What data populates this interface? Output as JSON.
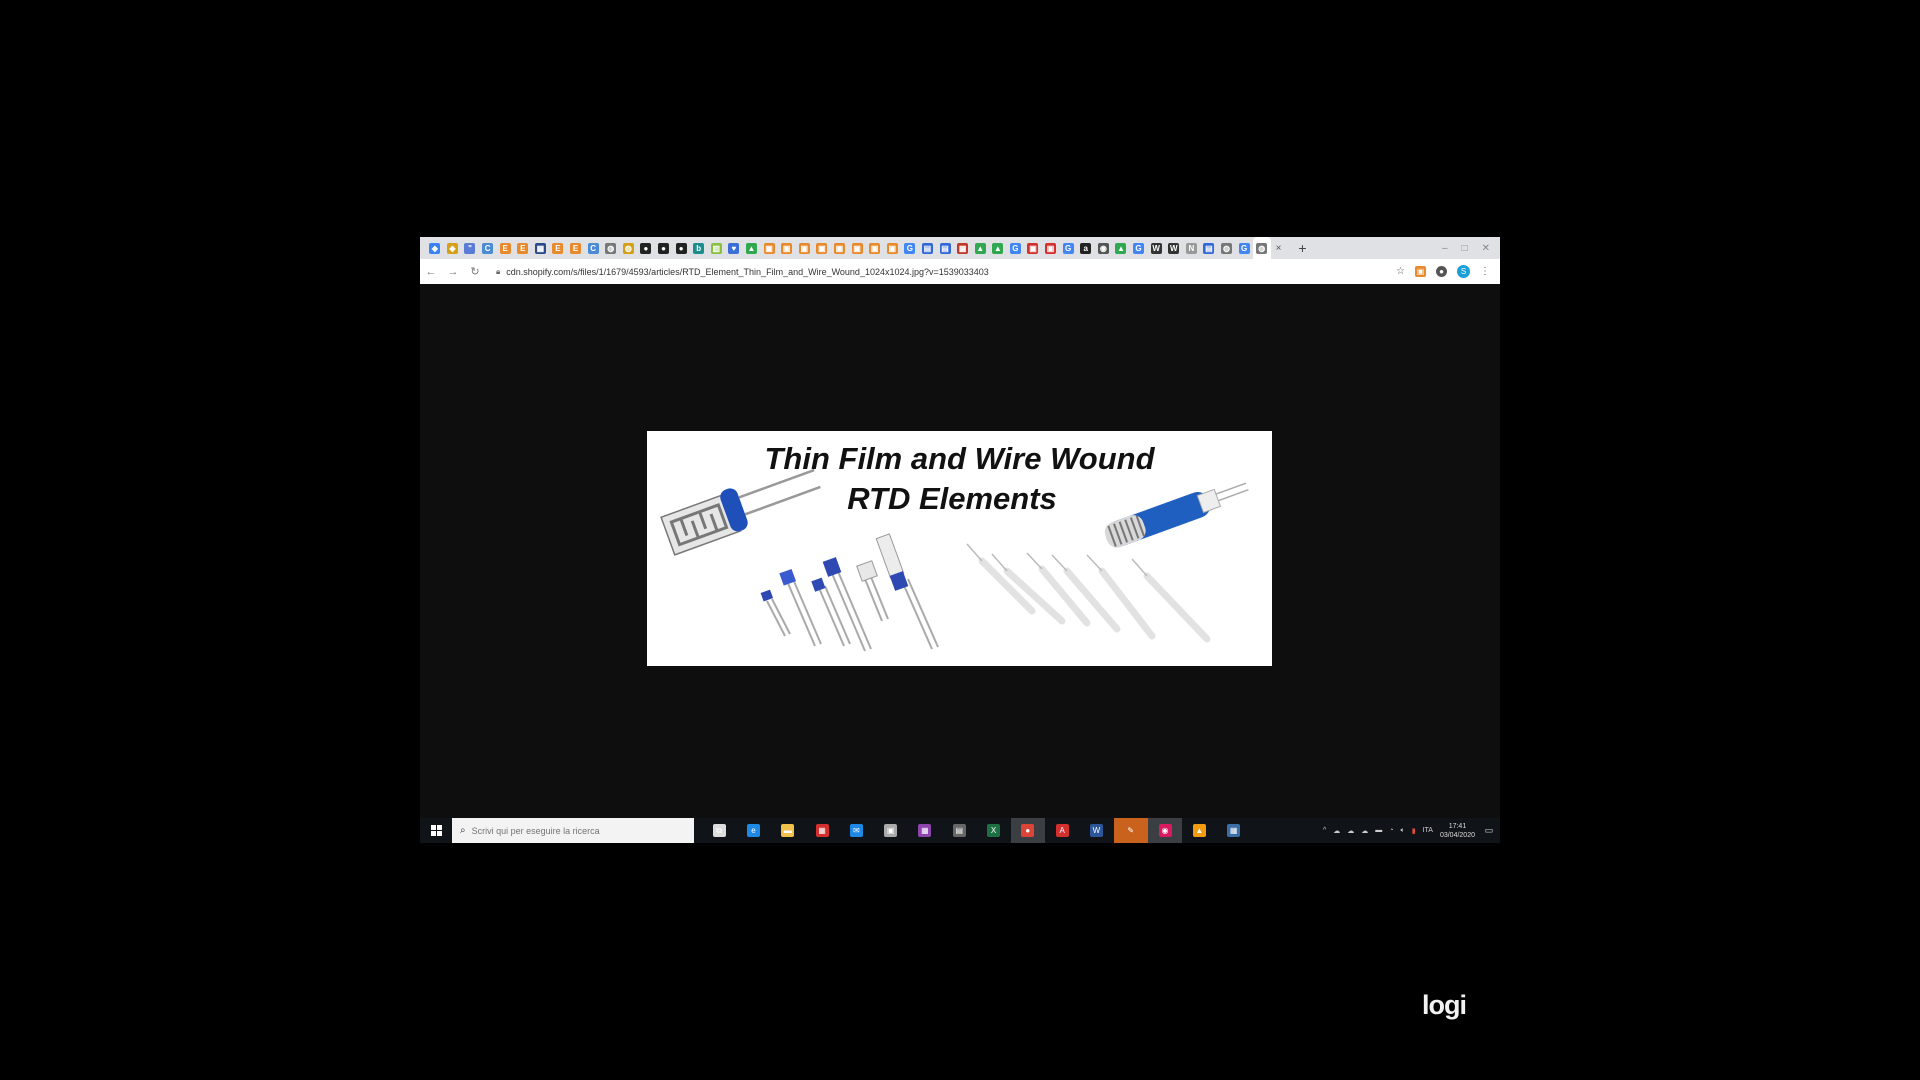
{
  "browser": {
    "tab_favicons": [
      {
        "icon": "diamond-icon",
        "color": "#3b82f6",
        "glyph": "◆"
      },
      {
        "icon": "diamond-icon",
        "color": "#d4a017",
        "glyph": "◆"
      },
      {
        "icon": "blog-icon",
        "color": "#5a7bd6",
        "glyph": "\""
      },
      {
        "icon": "c-icon",
        "color": "#4b8bd6",
        "glyph": "C"
      },
      {
        "icon": "e-icon",
        "color": "#e8892b",
        "glyph": "E"
      },
      {
        "icon": "e-icon",
        "color": "#e8892b",
        "glyph": "E"
      },
      {
        "icon": "grid-icon",
        "color": "#2a4a8a",
        "glyph": "▦"
      },
      {
        "icon": "e-icon",
        "color": "#e8892b",
        "glyph": "E"
      },
      {
        "icon": "e-icon",
        "color": "#e8892b",
        "glyph": "E"
      },
      {
        "icon": "c-icon",
        "color": "#4b8bd6",
        "glyph": "C"
      },
      {
        "icon": "globe-icon",
        "color": "#777",
        "glyph": "◍"
      },
      {
        "icon": "globe-icon",
        "color": "#d4a017",
        "glyph": "◍"
      },
      {
        "icon": "github-icon",
        "color": "#222",
        "glyph": "●"
      },
      {
        "icon": "github-icon",
        "color": "#222",
        "glyph": "●"
      },
      {
        "icon": "github-icon",
        "color": "#222",
        "glyph": "●"
      },
      {
        "icon": "b-icon",
        "color": "#1c8c8c",
        "glyph": "b"
      },
      {
        "icon": "sheet-icon",
        "color": "#8bbf3f",
        "glyph": "▥"
      },
      {
        "icon": "heart-icon",
        "color": "#3b6ed6",
        "glyph": "♥"
      },
      {
        "icon": "drive-icon",
        "color": "#2fa84f",
        "glyph": "▲"
      },
      {
        "icon": "orange-icon",
        "color": "#e8892b",
        "glyph": "▣"
      },
      {
        "icon": "orange-icon",
        "color": "#e8892b",
        "glyph": "▣"
      },
      {
        "icon": "orange-icon",
        "color": "#e8892b",
        "glyph": "▣"
      },
      {
        "icon": "orange-icon",
        "color": "#e8892b",
        "glyph": "▣"
      },
      {
        "icon": "orange-icon",
        "color": "#e8892b",
        "glyph": "▣"
      },
      {
        "icon": "orange-icon",
        "color": "#e8892b",
        "glyph": "▣"
      },
      {
        "icon": "orange-icon",
        "color": "#e8892b",
        "glyph": "▣"
      },
      {
        "icon": "orange-icon",
        "color": "#e8892b",
        "glyph": "▣"
      },
      {
        "icon": "google-icon",
        "color": "#4285f4",
        "glyph": "G"
      },
      {
        "icon": "doc-icon",
        "color": "#3367d6",
        "glyph": "▤"
      },
      {
        "icon": "doc-icon",
        "color": "#3367d6",
        "glyph": "▤"
      },
      {
        "icon": "flag-icon",
        "color": "#c0392b",
        "glyph": "▦"
      },
      {
        "icon": "drive-icon",
        "color": "#2fa84f",
        "glyph": "▲"
      },
      {
        "icon": "drive-icon",
        "color": "#2fa84f",
        "glyph": "▲"
      },
      {
        "icon": "google-icon",
        "color": "#4285f4",
        "glyph": "G"
      },
      {
        "icon": "red-icon",
        "color": "#d32f2f",
        "glyph": "▣"
      },
      {
        "icon": "red-icon",
        "color": "#d32f2f",
        "glyph": "▣"
      },
      {
        "icon": "google-icon",
        "color": "#4285f4",
        "glyph": "G"
      },
      {
        "icon": "amazon-icon",
        "color": "#222",
        "glyph": "a"
      },
      {
        "icon": "eye-icon",
        "color": "#555",
        "glyph": "◉"
      },
      {
        "icon": "drive-icon",
        "color": "#2fa84f",
        "glyph": "▲"
      },
      {
        "icon": "google-icon",
        "color": "#4285f4",
        "glyph": "G"
      },
      {
        "icon": "wikipedia-icon",
        "color": "#333",
        "glyph": "W"
      },
      {
        "icon": "wikipedia-icon",
        "color": "#333",
        "glyph": "W"
      },
      {
        "icon": "ms-icon",
        "color": "#999",
        "glyph": "N"
      },
      {
        "icon": "doc-icon",
        "color": "#3367d6",
        "glyph": "▤"
      },
      {
        "icon": "globe-icon",
        "color": "#777",
        "glyph": "◍"
      },
      {
        "icon": "google-icon",
        "color": "#4285f4",
        "glyph": "G"
      },
      {
        "icon": "globe-icon",
        "color": "#777",
        "glyph": "◍"
      }
    ],
    "active_tab_index": 47,
    "tab_close": "×",
    "new_tab": "+",
    "url": "cdn.shopify.com/s/files/1/1679/4593/articles/RTD_Element_Thin_Film_and_Wire_Wound_1024x1024.jpg?v=1539033403",
    "extension_colors": [
      "#e8892b",
      "#555"
    ],
    "profile_initial": "S"
  },
  "image": {
    "title_line1": "Thin Film and Wire Wound",
    "title_line2": "RTD Elements"
  },
  "taskbar": {
    "search_placeholder": "Scrivi qui per eseguire la ricerca",
    "apps": [
      {
        "icon": "task-view-icon",
        "color": "#ddd",
        "glyph": "⧉",
        "state": ""
      },
      {
        "icon": "edge-icon",
        "color": "#1e88e5",
        "glyph": "e",
        "state": ""
      },
      {
        "icon": "file-explorer-icon",
        "color": "#f0c14b",
        "glyph": "▬",
        "state": ""
      },
      {
        "icon": "calendar-icon",
        "color": "#d32f2f",
        "glyph": "▦",
        "state": ""
      },
      {
        "icon": "mail-icon",
        "color": "#1e88e5",
        "glyph": "✉",
        "state": ""
      },
      {
        "icon": "printer-icon",
        "color": "#aaa",
        "glyph": "▣",
        "state": ""
      },
      {
        "icon": "winrar-icon",
        "color": "#8e44ad",
        "glyph": "▦",
        "state": ""
      },
      {
        "icon": "notes-icon",
        "color": "#666",
        "glyph": "▤",
        "state": ""
      },
      {
        "icon": "excel-icon",
        "color": "#1d7044",
        "glyph": "X",
        "state": ""
      },
      {
        "icon": "chrome-icon",
        "color": "#db4437",
        "glyph": "●",
        "state": "running"
      },
      {
        "icon": "acrobat-icon",
        "color": "#d32f2f",
        "glyph": "A",
        "state": ""
      },
      {
        "icon": "word-icon",
        "color": "#2b579a",
        "glyph": "W",
        "state": ""
      },
      {
        "icon": "pen-icon",
        "color": "#c8621c",
        "glyph": "✎",
        "state": "orange"
      },
      {
        "icon": "screen-recorder-icon",
        "color": "#d81b60",
        "glyph": "◉",
        "state": "running"
      },
      {
        "icon": "vlc-icon",
        "color": "#f39c12",
        "glyph": "▲",
        "state": ""
      },
      {
        "icon": "network-tool-icon",
        "color": "#3a6ea5",
        "glyph": "▦",
        "state": ""
      }
    ],
    "language": "ITA",
    "time": "17:41",
    "date": "03/04/2020"
  },
  "overlay": {
    "brand": "logi"
  }
}
